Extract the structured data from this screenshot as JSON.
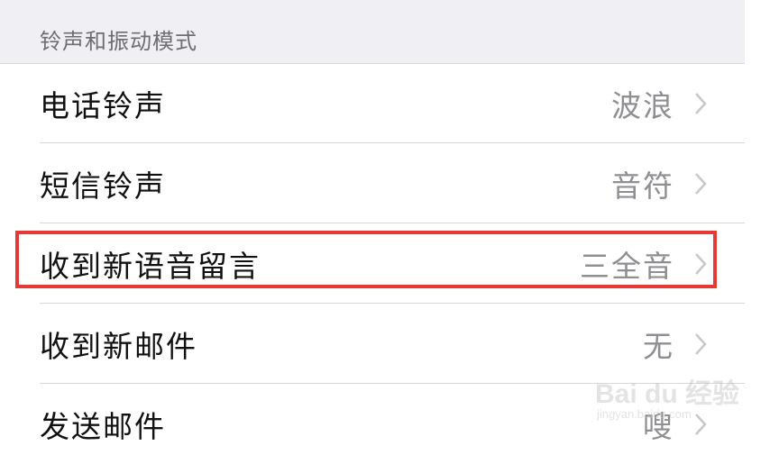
{
  "section": {
    "title": "铃声和振动模式"
  },
  "rows": [
    {
      "label": "电话铃声",
      "value": "波浪",
      "icon": "chevron-right-icon"
    },
    {
      "label": "短信铃声",
      "value": "音符",
      "icon": "chevron-right-icon"
    },
    {
      "label": "收到新语音留言",
      "value": "三全音",
      "icon": "chevron-right-icon",
      "highlighted": true
    },
    {
      "label": "收到新邮件",
      "value": "无",
      "icon": "chevron-right-icon"
    },
    {
      "label": "发送邮件",
      "value": "嗖",
      "icon": "chevron-right-icon"
    }
  ],
  "watermark": {
    "brand": "Bai du 经验",
    "url": "jingyan.baidu.com"
  },
  "colors": {
    "header_bg": "#efeff4",
    "highlight": "#e53935",
    "value_text": "#8e8e93"
  }
}
